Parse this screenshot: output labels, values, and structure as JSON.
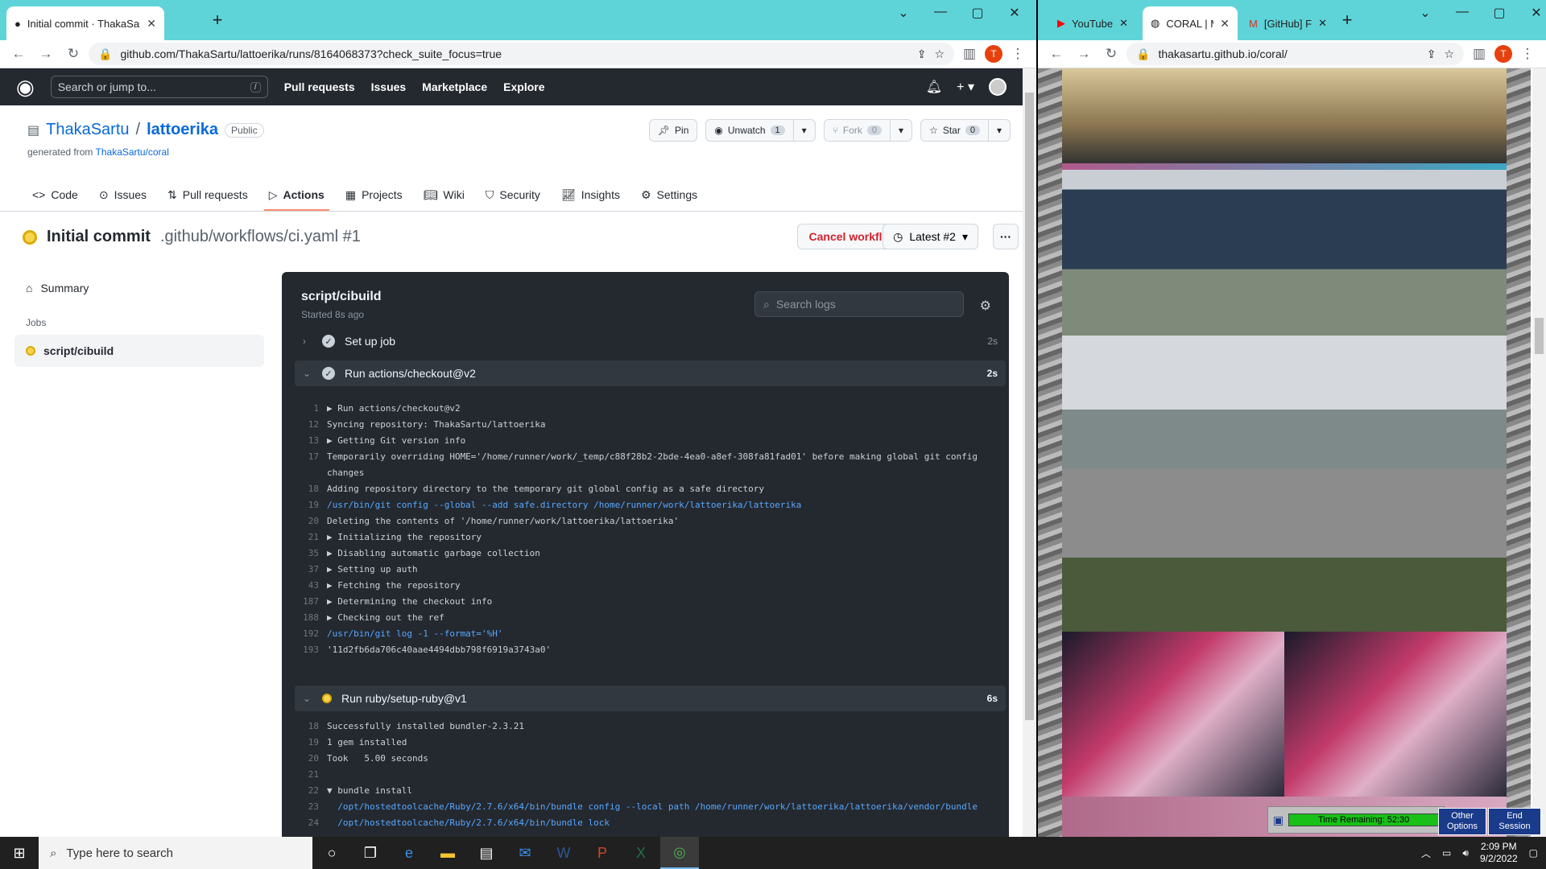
{
  "left_browser": {
    "tab_title": "Initial commit · ThakaSartu/lattoe",
    "tab_close": "✕",
    "new_tab": "+",
    "url": "github.com/ThakaSartu/lattoerika/runs/8164068373?check_suite_focus=true",
    "profile_initial": "T",
    "win_controls": [
      "⌄",
      "—",
      "▢",
      "✕"
    ]
  },
  "github": {
    "search_placeholder": "Search or jump to...",
    "search_key": "/",
    "nav": [
      "Pull requests",
      "Issues",
      "Marketplace",
      "Explore"
    ],
    "repo_owner": "ThakaSartu",
    "repo_sep": "/",
    "repo_name": "lattoerika",
    "visibility": "Public",
    "generated_prefix": "generated from",
    "generated_link": "ThakaSartu/coral",
    "pin": "Pin",
    "unwatch": "Unwatch",
    "unwatch_count": "1",
    "fork": "Fork",
    "fork_count": "0",
    "star": "Star",
    "star_count": "0",
    "repo_tabs": [
      "Code",
      "Issues",
      "Pull requests",
      "Actions",
      "Projects",
      "Wiki",
      "Security",
      "Insights",
      "Settings"
    ],
    "run_title": "Initial commit",
    "run_path": ".github/workflows/ci.yaml #1",
    "cancel": "Cancel workflow",
    "latest": "Latest #2",
    "more": "···",
    "summary": "Summary",
    "jobs_header": "Jobs",
    "job_name": "script/cibuild"
  },
  "log": {
    "job": "script/cibuild",
    "started": "Started 8s ago",
    "search_placeholder": "Search logs",
    "steps": [
      {
        "name": "Set up job",
        "dur": "2s"
      },
      {
        "name": "Run actions/checkout@v2",
        "dur": "2s"
      },
      {
        "name": "Run ruby/setup-ruby@v1",
        "dur": "6s"
      }
    ],
    "checkout_lines": [
      {
        "n": "1",
        "t": "▶ Run actions/checkout@v2",
        "cmd": false
      },
      {
        "n": "12",
        "t": "Syncing repository: ThakaSartu/lattoerika",
        "cmd": false
      },
      {
        "n": "13",
        "t": "▶ Getting Git version info",
        "cmd": false
      },
      {
        "n": "17",
        "t": "Temporarily overriding HOME='/home/runner/work/_temp/c88f28b2-2bde-4ea0-a8ef-308fa81fad01' before making global git config changes",
        "cmd": false
      },
      {
        "n": "18",
        "t": "Adding repository directory to the temporary git global config as a safe directory",
        "cmd": false
      },
      {
        "n": "19",
        "t": "/usr/bin/git config --global --add safe.directory /home/runner/work/lattoerika/lattoerika",
        "cmd": true
      },
      {
        "n": "20",
        "t": "Deleting the contents of '/home/runner/work/lattoerika/lattoerika'",
        "cmd": false
      },
      {
        "n": "21",
        "t": "▶ Initializing the repository",
        "cmd": false
      },
      {
        "n": "35",
        "t": "▶ Disabling automatic garbage collection",
        "cmd": false
      },
      {
        "n": "37",
        "t": "▶ Setting up auth",
        "cmd": false
      },
      {
        "n": "43",
        "t": "▶ Fetching the repository",
        "cmd": false
      },
      {
        "n": "187",
        "t": "▶ Determining the checkout info",
        "cmd": false
      },
      {
        "n": "188",
        "t": "▶ Checking out the ref",
        "cmd": false
      },
      {
        "n": "192",
        "t": "/usr/bin/git log -1 --format='%H'",
        "cmd": true
      },
      {
        "n": "193",
        "t": "'11d2fb6da706c40aae4494dbb798f6919a3743a0'",
        "cmd": false
      }
    ],
    "ruby_lines": [
      {
        "n": "18",
        "t": "Successfully installed bundler-2.3.21",
        "cmd": false
      },
      {
        "n": "19",
        "t": "1 gem installed",
        "cmd": false
      },
      {
        "n": "20",
        "t": "Took   5.00 seconds",
        "cmd": false
      },
      {
        "n": "21",
        "t": "",
        "cmd": false
      },
      {
        "n": "22",
        "t": "▼ bundle install",
        "cmd": false
      },
      {
        "n": "23",
        "t": "  /opt/hostedtoolcache/Ruby/2.7.6/x64/bin/bundle config --local path /home/runner/work/lattoerika/lattoerika/vendor/bundle",
        "cmd": true
      },
      {
        "n": "24",
        "t": "  /opt/hostedtoolcache/Ruby/2.7.6/x64/bin/bundle lock",
        "cmd": true
      }
    ]
  },
  "right_browser": {
    "tabs": [
      "YouTube",
      "CORAL | M",
      "[GitHub] F"
    ],
    "url": "thakasartu.github.io/coral/",
    "profile_initial": "T"
  },
  "taskbar": {
    "search": "Type here to search",
    "time": "2:09 PM",
    "date": "9/2/2022"
  },
  "session": {
    "time_remaining": "Time Remaining: 52:30",
    "other": "Other Options",
    "end": "End Session"
  }
}
